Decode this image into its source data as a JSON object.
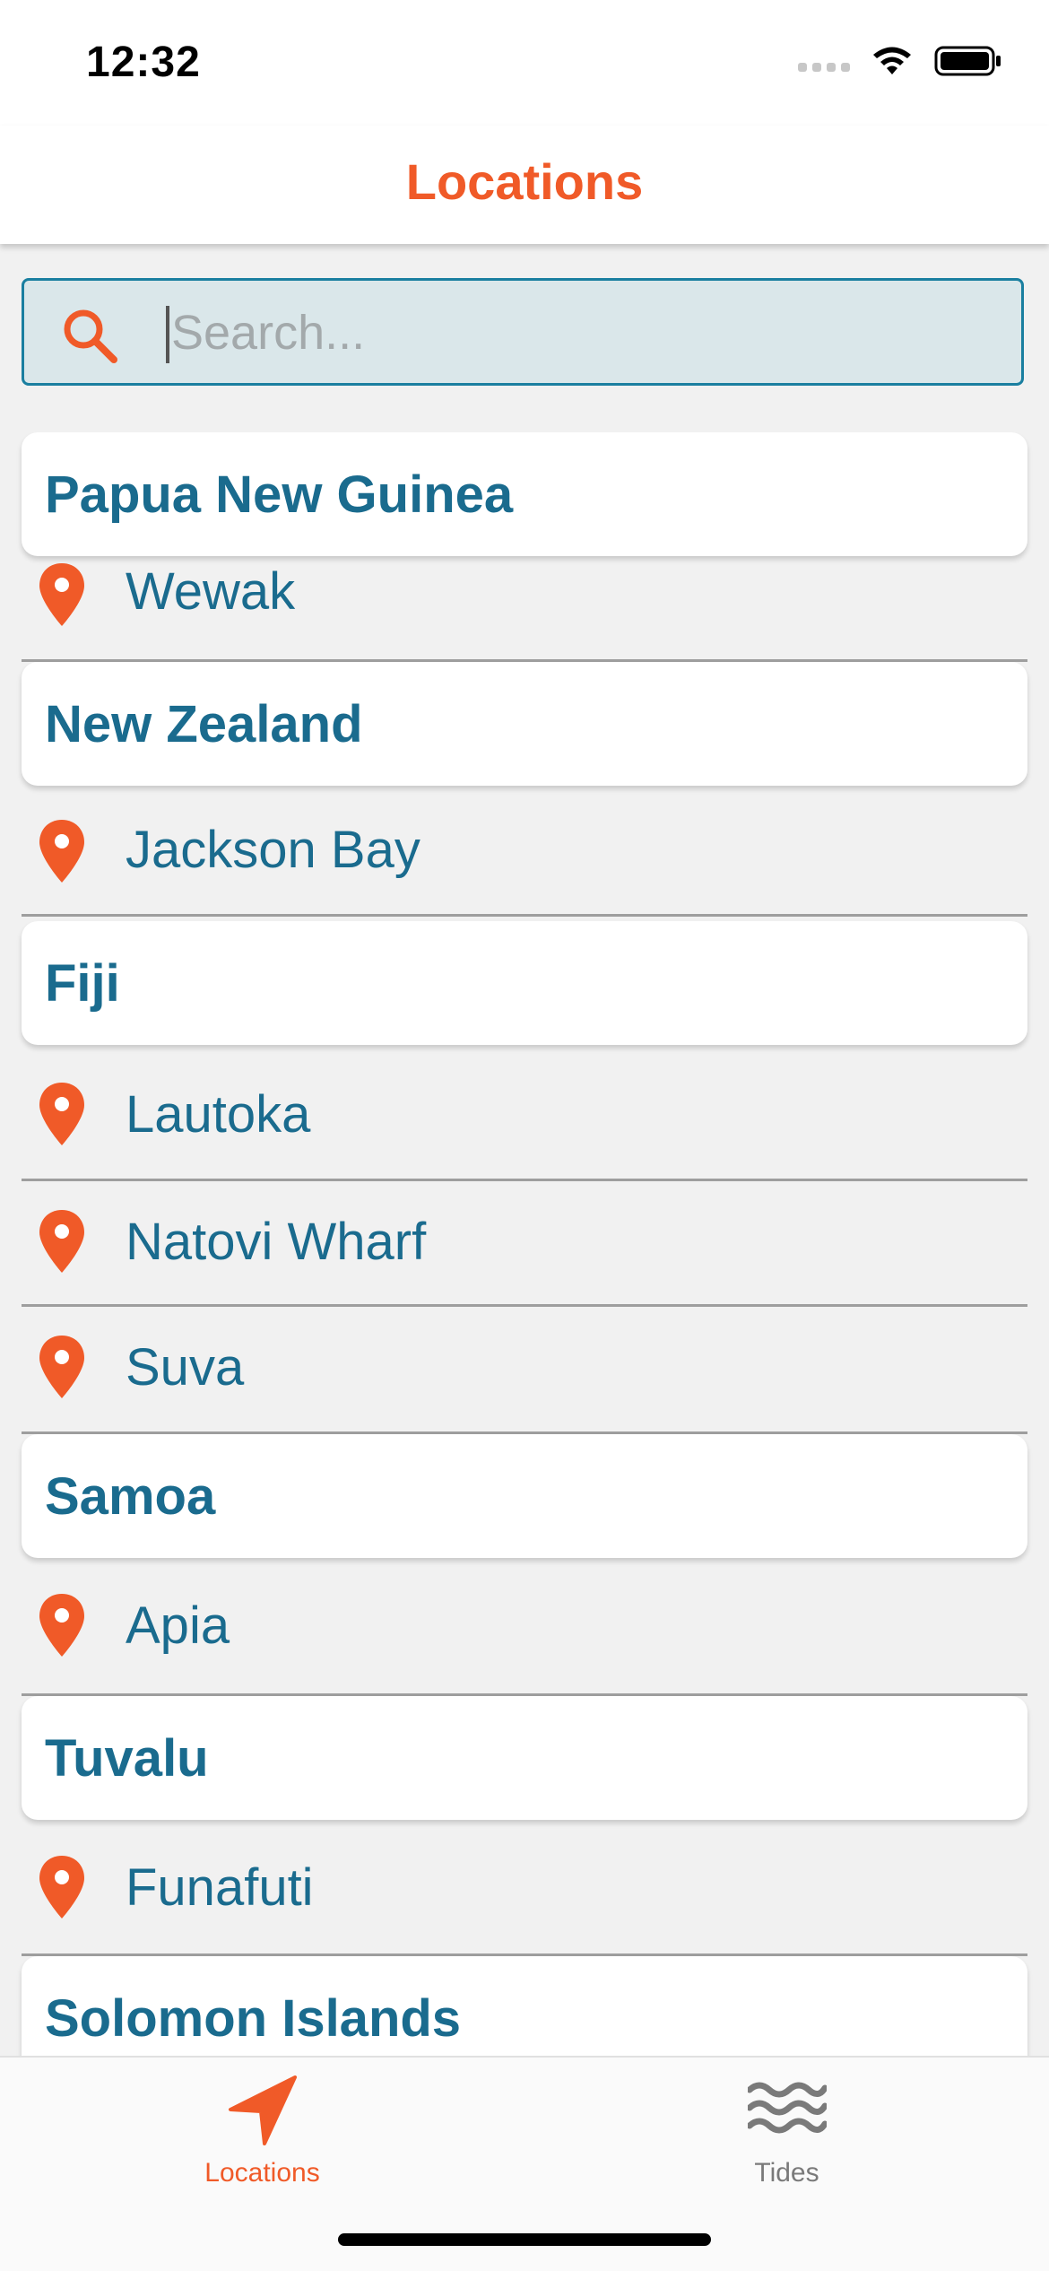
{
  "status_bar": {
    "time": "12:32"
  },
  "header": {
    "title": "Locations"
  },
  "search": {
    "placeholder": "Search..."
  },
  "groups": [
    {
      "country": "Papua New Guinea",
      "locations": [
        "Wewak"
      ]
    },
    {
      "country": "New Zealand",
      "locations": [
        "Jackson Bay"
      ]
    },
    {
      "country": "Fiji",
      "locations": [
        "Lautoka",
        "Natovi Wharf",
        "Suva"
      ]
    },
    {
      "country": "Samoa",
      "locations": [
        "Apia"
      ]
    },
    {
      "country": "Tuvalu",
      "locations": [
        "Funafuti"
      ]
    },
    {
      "country": "Solomon Islands",
      "locations": []
    }
  ],
  "tab_bar": {
    "tabs": [
      {
        "label": "Locations",
        "icon": "navigation-arrow-icon",
        "active": true
      },
      {
        "label": "Tides",
        "icon": "waves-icon",
        "active": false
      }
    ]
  },
  "colors": {
    "accent": "#f05a28",
    "text_primary": "#1a6b8e",
    "search_background": "#dae7ea",
    "search_border": "#1a7fa0",
    "list_background": "#f1f1f1",
    "inactive_tab": "#7a7a7a"
  }
}
